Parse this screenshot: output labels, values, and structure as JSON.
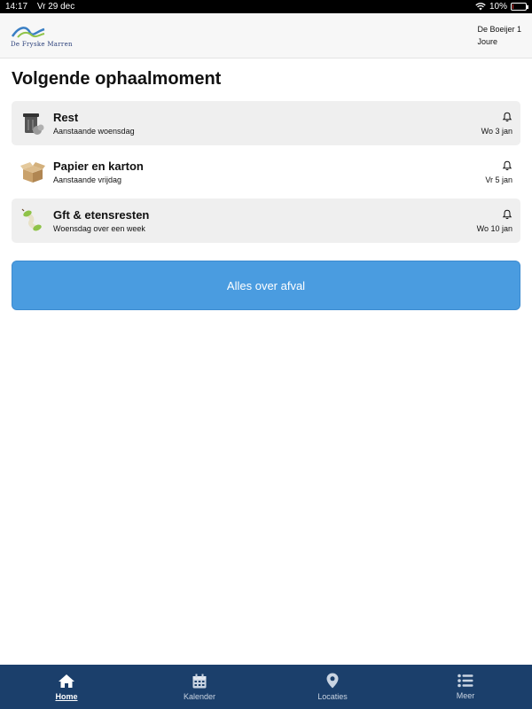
{
  "statusbar": {
    "time": "14:17",
    "date": "Vr 29 dec",
    "battery": "10%",
    "battery_level": 0.1
  },
  "header": {
    "logo_text": "De Fryske Marren",
    "address_line1": "De Boeijer 1",
    "address_line2": "Joure"
  },
  "page_title": "Volgende ophaalmoment",
  "pickups": [
    {
      "name": "Rest",
      "sub": "Aanstaande woensdag",
      "date": "Wo 3 jan",
      "icon": "grey-bin-icon"
    },
    {
      "name": "Papier en karton",
      "sub": "Aanstaande vrijdag",
      "date": "Vr 5 jan",
      "icon": "cardboard-box-icon"
    },
    {
      "name": "Gft & etensresten",
      "sub": "Woensdag over een week",
      "date": "Wo 10 jan",
      "icon": "apple-core-icon"
    }
  ],
  "cta_label": "Alles over afval",
  "tabs": [
    {
      "label": "Home",
      "icon": "home-icon"
    },
    {
      "label": "Kalender",
      "icon": "calendar-icon"
    },
    {
      "label": "Locaties",
      "icon": "map-pin-icon"
    },
    {
      "label": "Meer",
      "icon": "list-icon"
    }
  ],
  "colors": {
    "accent": "#4a9ce0",
    "tabbar": "#1b3f6b"
  }
}
